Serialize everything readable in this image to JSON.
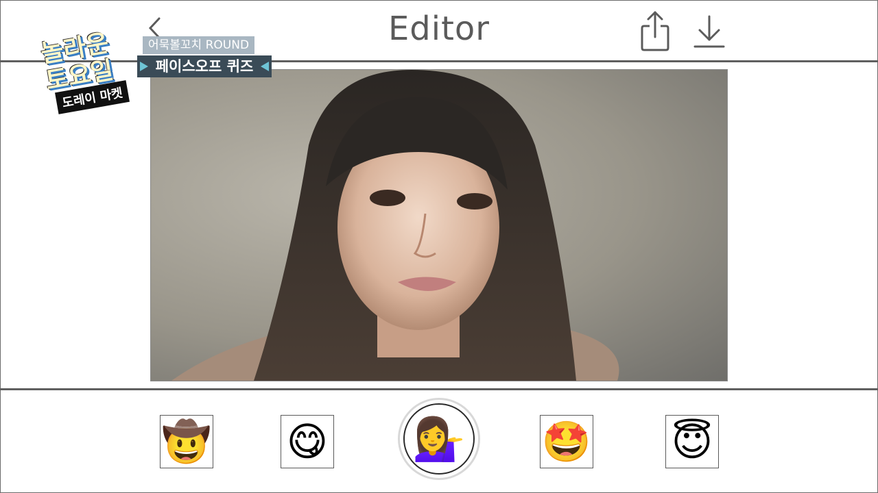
{
  "header": {
    "title": "Editor",
    "back_icon": "chevron-left-icon",
    "share_icon": "share-icon",
    "download_icon": "download-icon"
  },
  "overlay": {
    "logo_line1": "놀라운",
    "logo_line2": "토요일",
    "logo_sub": "도레이 마켓",
    "round_label": "어묵볼꼬치 ROUND",
    "quiz_label": "페이스오프 퀴즈"
  },
  "photo": {
    "description_icon": "portrait-photo"
  },
  "emojis": [
    {
      "name": "cowboy-face",
      "glyph": "🤠"
    },
    {
      "name": "face-savoring-food",
      "glyph": "😋"
    },
    {
      "name": "person-tipping-hand",
      "glyph": "💁‍♀️",
      "selected": true
    },
    {
      "name": "star-struck",
      "glyph": "🤩"
    },
    {
      "name": "smiling-face-with-halo",
      "glyph": "😇"
    }
  ],
  "colors": {
    "line": "#5f5f5f",
    "title": "#5b5b5b",
    "quiz_bg": "#3a4b57",
    "round_bg": "#a9b7c2"
  }
}
